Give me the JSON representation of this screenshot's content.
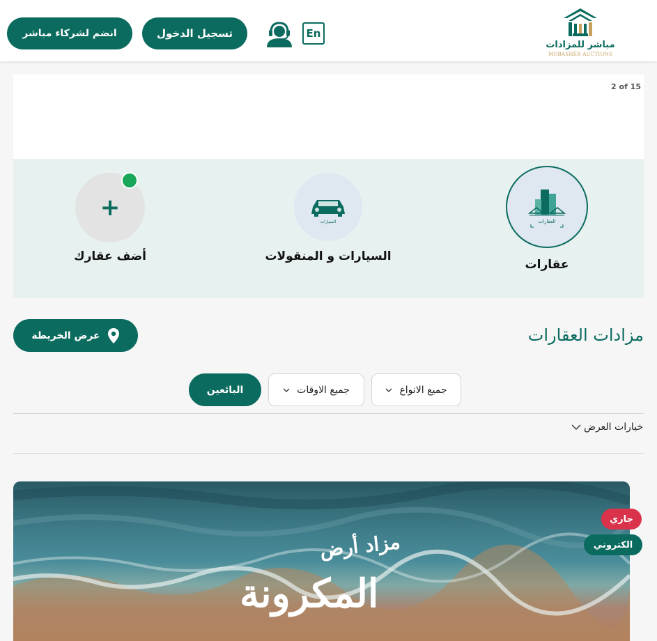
{
  "header": {
    "join_label": "انضم لشركاء مباشر",
    "login_label": "تسجيل الدخول",
    "lang_label": "En",
    "logo_name": "مباشر للمزادات",
    "logo_sub": "MOBASHER AUCTIONS"
  },
  "slider": {
    "counter": "2 of 15"
  },
  "categories": [
    {
      "label": "عقارات",
      "active": true,
      "icon_caption": "العقارات"
    },
    {
      "label": "السيارات و المنقولات",
      "active": false,
      "icon_caption": "السيارات"
    },
    {
      "label": "أضف عقارك",
      "active": false
    }
  ],
  "section": {
    "title": "مزادات العقارات",
    "map_label": "عرض الخريطة"
  },
  "filters": {
    "types": "جميع الانواع",
    "times": "جميع الاوقات",
    "sellers": "البائعين"
  },
  "view_options": "خيارات العرض",
  "card": {
    "title_line1": "مزاد أرض",
    "title_line2": "المكرونة",
    "badges": {
      "status": "جاري",
      "type": "الكتروني"
    }
  },
  "colors": {
    "primary": "#0b6b5f",
    "live": "#d9324a",
    "dot": "#1aa75a"
  }
}
